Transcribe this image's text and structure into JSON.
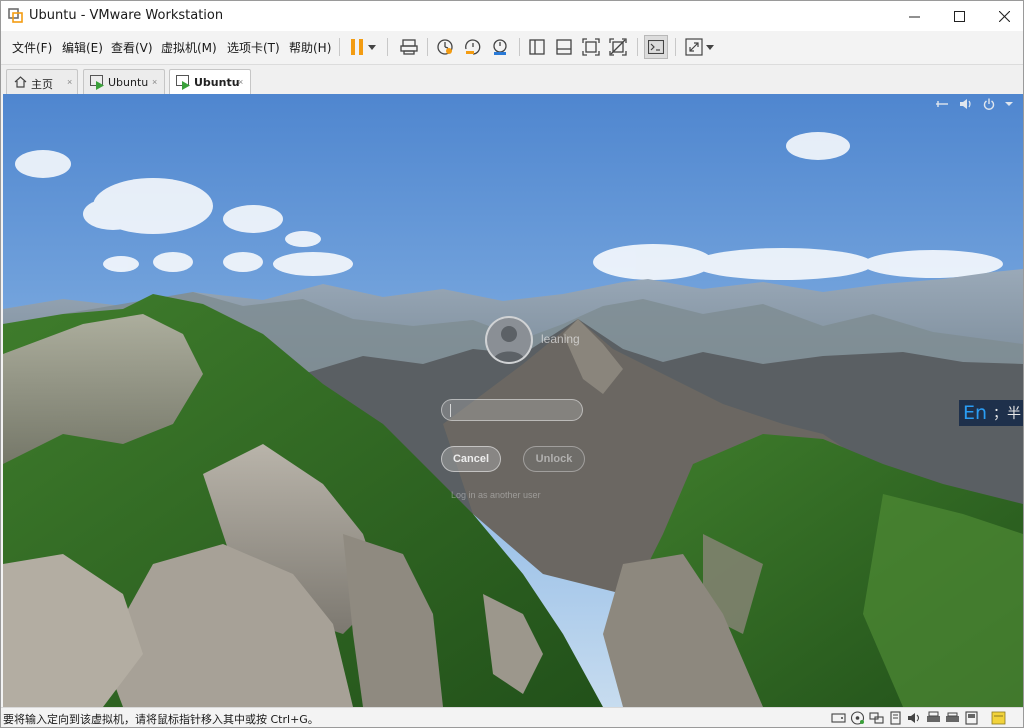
{
  "window": {
    "title": "Ubuntu - VMware Workstation"
  },
  "menu": {
    "items": [
      "文件(F)",
      "编辑(E)",
      "查看(V)",
      "虚拟机(M)",
      "选项卡(T)",
      "帮助(H)"
    ]
  },
  "toolbar": {
    "icons": [
      "pause-icon",
      "dropdown-arrow-icon",
      "send-ctrl-alt-del-icon",
      "snapshot-take-icon",
      "snapshot-revert-icon",
      "snapshot-manager-icon",
      "sidebar-toggle-icon",
      "thumbnail-bar-icon",
      "fit-guest-icon",
      "stretch-icon",
      "console-view-icon",
      "fullscreen-icon",
      "fullscreen-dropdown-icon"
    ],
    "accent": "#f39c12"
  },
  "tabs": [
    {
      "label": "主页",
      "active": false
    },
    {
      "label": "Ubuntu",
      "active": false
    },
    {
      "label": "Ubuntu",
      "active": true
    }
  ],
  "lockscreen": {
    "username": "leaning",
    "password_value": "",
    "cancel_label": "Cancel",
    "unlock_label": "Unlock",
    "another_user": "Log in as another user",
    "top_icons": [
      "network-icon",
      "volume-icon",
      "power-icon",
      "chevron-down-icon"
    ]
  },
  "ime": {
    "lang": "En",
    "rest": "；半"
  },
  "statusbar": {
    "hint": "要将输入定向到该虚拟机，请将鼠标指针移入其中或按 Ctrl+G。",
    "device_icons": [
      "hard-disk-icon",
      "cd-dvd-icon",
      "network-adapter-icon",
      "usb-icon",
      "sound-icon",
      "printer-icon",
      "display-icon",
      "removable-device-icon",
      "message-icon"
    ]
  }
}
